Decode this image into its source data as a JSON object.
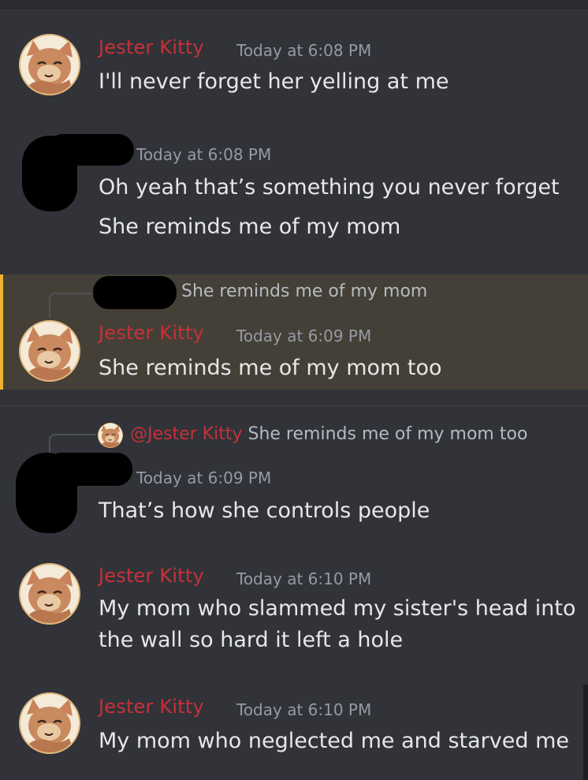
{
  "colors": {
    "background": "#313338",
    "author": "#c8303a",
    "timestamp": "#949ba4",
    "highlight": "#444037",
    "highlight_bar": "#f0b232"
  },
  "messages": [
    {
      "author": "Jester Kitty",
      "timestamp": "Today at 6:08 PM",
      "lines": [
        "I'll never forget her yelling at me"
      ]
    },
    {
      "author": "",
      "timestamp": "Today at 6:08 PM",
      "lines": [
        "Oh yeah that’s something you never forget",
        "She reminds me of my mom"
      ]
    },
    {
      "reply_to": {
        "text": "She reminds me of my mom"
      },
      "author": "Jester Kitty",
      "timestamp": "Today at 6:09 PM",
      "lines": [
        "She reminds me of my mom too"
      ]
    },
    {
      "reply_to": {
        "mention": "@Jester Kitty",
        "text": "She reminds me of my mom too"
      },
      "author": "",
      "timestamp": "Today at 6:09 PM",
      "lines": [
        "That’s how she controls people"
      ]
    },
    {
      "author": "Jester Kitty",
      "timestamp": "Today at 6:10 PM",
      "lines": [
        "My mom who slammed my sister's head into",
        "the wall so hard it left a hole"
      ]
    },
    {
      "author": "Jester Kitty",
      "timestamp": "Today at 6:10 PM",
      "lines": [
        "My mom who neglected me and starved me"
      ]
    }
  ]
}
